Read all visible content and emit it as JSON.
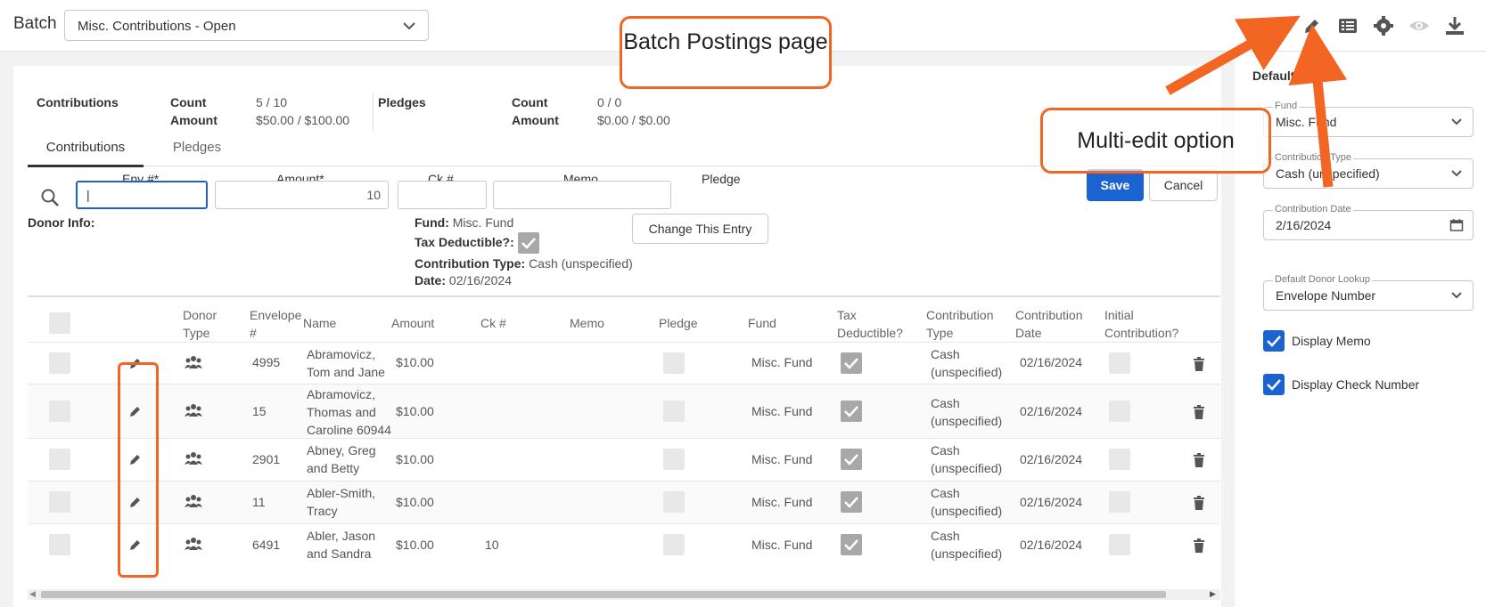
{
  "topbar": {
    "batch_label": "Batch",
    "batch_select": "Misc. Contributions - Open",
    "icons": [
      "pencil-icon",
      "list-icon",
      "gear-icon",
      "eye-icon",
      "download-icon"
    ]
  },
  "summary": {
    "contributions_label": "Contributions",
    "count_label": "Count",
    "count_value": "5 / 10",
    "amount_label": "Amount",
    "amount_value": "$50.00 / $100.00",
    "pledges_label": "Pledges",
    "pledges_count_value": "0 / 0",
    "pledges_amount_value": "$0.00 / $0.00"
  },
  "tabs": [
    "Contributions",
    "Pledges"
  ],
  "entry": {
    "env_label": "Env #*",
    "amount_label": "Amount*",
    "ck_label": "Ck #",
    "memo_label": "Memo",
    "pledge_label": "Pledge",
    "amount_value": "10",
    "env_value": "|",
    "save": "Save",
    "cancel": "Cancel",
    "donor_info": "Donor Info:",
    "fund_label": "Fund:",
    "fund_value": "Misc. Fund",
    "tax_label": "Tax Deductible?:",
    "ctype_label": "Contribution Type:",
    "ctype_value": "Cash (unspecified)",
    "date_label": "Date:",
    "date_value": "02/16/2024",
    "change_entry": "Change This Entry"
  },
  "table": {
    "headers": {
      "donor_type": "Donor Type",
      "envelope": "Envelope #",
      "name": "Name",
      "amount": "Amount",
      "ck": "Ck #",
      "memo": "Memo",
      "pledge": "Pledge",
      "fund": "Fund",
      "tax": "Tax Deductible?",
      "ctype": "Contribution Type",
      "cdate": "Contribution Date",
      "initial": "Initial Contribution?"
    },
    "rows": [
      {
        "envelope": "4995",
        "name": "Abramovicz, Tom and Jane",
        "amount": "$10.00",
        "ck": "",
        "fund": "Misc. Fund",
        "ctype": "Cash (unspecified)",
        "date": "02/16/2024"
      },
      {
        "envelope": "15",
        "name": "Abramovicz, Thomas and Caroline 60944",
        "amount": "$10.00",
        "ck": "",
        "fund": "Misc. Fund",
        "ctype": "Cash (unspecified)",
        "date": "02/16/2024"
      },
      {
        "envelope": "2901",
        "name": "Abney, Greg and Betty",
        "amount": "$10.00",
        "ck": "",
        "fund": "Misc. Fund",
        "ctype": "Cash (unspecified)",
        "date": "02/16/2024"
      },
      {
        "envelope": "11",
        "name": "Abler-Smith, Tracy",
        "amount": "$10.00",
        "ck": "",
        "fund": "Misc. Fund",
        "ctype": "Cash (unspecified)",
        "date": "02/16/2024"
      },
      {
        "envelope": "6491",
        "name": "Abler, Jason and Sandra",
        "amount": "$10.00",
        "ck": "10",
        "fund": "Misc. Fund",
        "ctype": "Cash (unspecified)",
        "date": "02/16/2024"
      }
    ]
  },
  "defaults": {
    "title": "Defaults",
    "fund_label": "Fund",
    "fund_value": "Misc. Fund",
    "ctype_label": "Contribution Type",
    "ctype_value": "Cash (unspecified)",
    "cdate_label": "Contribution Date",
    "cdate_value": "2/16/2024",
    "lookup_label": "Default Donor Lookup",
    "lookup_value": "Envelope Number",
    "display_memo": "Display Memo",
    "display_check": "Display Check Number"
  },
  "callouts": {
    "batch_postings": "Batch Postings page",
    "multi_edit": "Multi-edit option"
  },
  "colors": {
    "accent": "#1a63d1",
    "callout": "#f26522"
  }
}
